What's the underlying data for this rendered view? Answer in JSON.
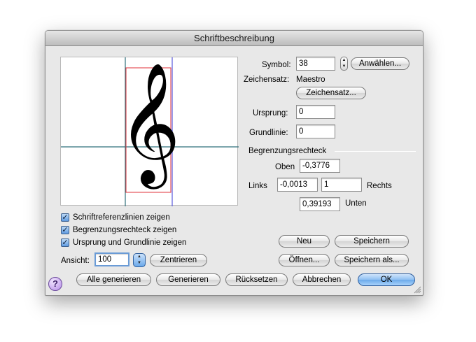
{
  "window": {
    "title": "Schriftbeschreibung"
  },
  "preview": {
    "glyph": "𝄞"
  },
  "symbol": {
    "label": "Symbol:",
    "value": "38",
    "choose_button": "Anwählen..."
  },
  "charset": {
    "label": "Zeichensatz:",
    "value": "Maestro",
    "button": "Zeichensatz..."
  },
  "origin": {
    "label": "Ursprung:",
    "value": "0"
  },
  "baseline": {
    "label": "Grundlinie:",
    "value": "0"
  },
  "bounding_box": {
    "heading": "Begrenzungsrechteck",
    "top_label": "Oben",
    "top_value": "-0,3776",
    "left_label": "Links",
    "left_value": "-0,0013",
    "right_value": "1",
    "right_label": "Rechts",
    "bottom_value": "0,39193",
    "bottom_label": "Unten"
  },
  "checkboxes": [
    {
      "label": "Schriftreferenzlinien zeigen",
      "checked": true
    },
    {
      "label": "Begrenzungsrechteck zeigen",
      "checked": true
    },
    {
      "label": "Ursprung und Grundlinie zeigen",
      "checked": true
    }
  ],
  "view": {
    "label": "Ansicht:",
    "value": "100",
    "center_button": "Zentrieren"
  },
  "buttons": {
    "new": "Neu",
    "save": "Speichern",
    "open": "Öffnen...",
    "save_as": "Speichern als...",
    "generate_all": "Alle generieren",
    "generate": "Generieren",
    "reset": "Rücksetzen",
    "cancel": "Abbrechen",
    "ok": "OK",
    "help": "?"
  },
  "colors": {
    "bbox": "#e0303a",
    "ref_lines": "#2f6f7a",
    "origin_line": "#5a5adc",
    "default_button": "#6aa9ea"
  }
}
